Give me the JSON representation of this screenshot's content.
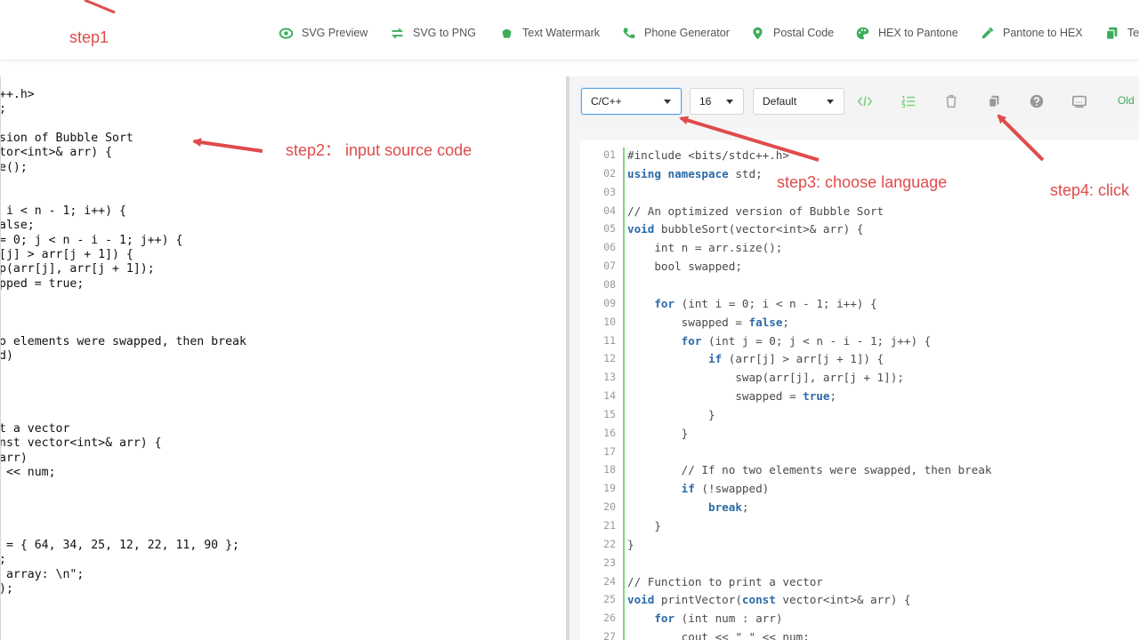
{
  "steps": {
    "step1": "step1",
    "step2": "step2： input source code",
    "step3": "step3: choose language",
    "step4": "step4: click"
  },
  "nav": [
    {
      "label": "SVG Preview",
      "icon": "eye-icon"
    },
    {
      "label": "SVG to PNG",
      "icon": "swap-arrows-icon"
    },
    {
      "label": "Text Watermark",
      "icon": "watermark-icon"
    },
    {
      "label": "Phone Generator",
      "icon": "phone-icon"
    },
    {
      "label": "Postal Code",
      "icon": "map-pin-icon"
    },
    {
      "label": "HEX to Pantone",
      "icon": "palette-icon"
    },
    {
      "label": "Pantone to HEX",
      "icon": "eyedropper-icon"
    },
    {
      "label": "Te",
      "icon": "copy-icon"
    }
  ],
  "toolbar": {
    "language": "C/C++",
    "font_size": "16",
    "theme": "Default",
    "old_label": "Old"
  },
  "left_code": [
    "++.h>",
    ";",
    "",
    "sion of Bubble Sort",
    "tor<int>& arr) {",
    "e();",
    "",
    "",
    " i < n - 1; i++) {",
    "alse;",
    "= 0; j < n - i - 1; j++) {",
    "[j] > arr[j + 1]) {",
    "p(arr[j], arr[j + 1]);",
    "pped = true;",
    "",
    "",
    "",
    "o elements were swapped, then break",
    "d)",
    "",
    "",
    "",
    "",
    "t a vector",
    "nst vector<int>& arr) {",
    "arr)",
    " << num;",
    "",
    "",
    "",
    "",
    " = { 64, 34, 25, 12, 22, 11, 90 };",
    ";",
    " array: \\n\";",
    ");"
  ],
  "right_code": [
    {
      "n": "01",
      "t": "#include <bits/stdc++.h>"
    },
    {
      "n": "02",
      "t": "using namespace std;"
    },
    {
      "n": "03",
      "t": ""
    },
    {
      "n": "04",
      "t": "// An optimized version of Bubble Sort"
    },
    {
      "n": "05",
      "t": "void bubbleSort(vector<int>& arr) {"
    },
    {
      "n": "06",
      "t": "    int n = arr.size();"
    },
    {
      "n": "07",
      "t": "    bool swapped;"
    },
    {
      "n": "08",
      "t": ""
    },
    {
      "n": "09",
      "t": "    for (int i = 0; i < n - 1; i++) {"
    },
    {
      "n": "10",
      "t": "        swapped = false;"
    },
    {
      "n": "11",
      "t": "        for (int j = 0; j < n - i - 1; j++) {"
    },
    {
      "n": "12",
      "t": "            if (arr[j] > arr[j + 1]) {"
    },
    {
      "n": "13",
      "t": "                swap(arr[j], arr[j + 1]);"
    },
    {
      "n": "14",
      "t": "                swapped = true;"
    },
    {
      "n": "15",
      "t": "            }"
    },
    {
      "n": "16",
      "t": "        }"
    },
    {
      "n": "17",
      "t": ""
    },
    {
      "n": "18",
      "t": "        // If no two elements were swapped, then break"
    },
    {
      "n": "19",
      "t": "        if (!swapped)"
    },
    {
      "n": "20",
      "t": "            break;"
    },
    {
      "n": "21",
      "t": "    }"
    },
    {
      "n": "22",
      "t": "}"
    },
    {
      "n": "23",
      "t": ""
    },
    {
      "n": "24",
      "t": "// Function to print a vector"
    },
    {
      "n": "25",
      "t": "void printVector(const vector<int>& arr) {"
    },
    {
      "n": "26",
      "t": "    for (int num : arr)"
    },
    {
      "n": "27",
      "t": "        cout << \" \" << num;"
    }
  ],
  "colors": {
    "accent_green": "#3cae5a",
    "annotation_red": "#e04b4b",
    "keyword_blue": "#2b6aa8",
    "comment_green": "#4caf50"
  }
}
